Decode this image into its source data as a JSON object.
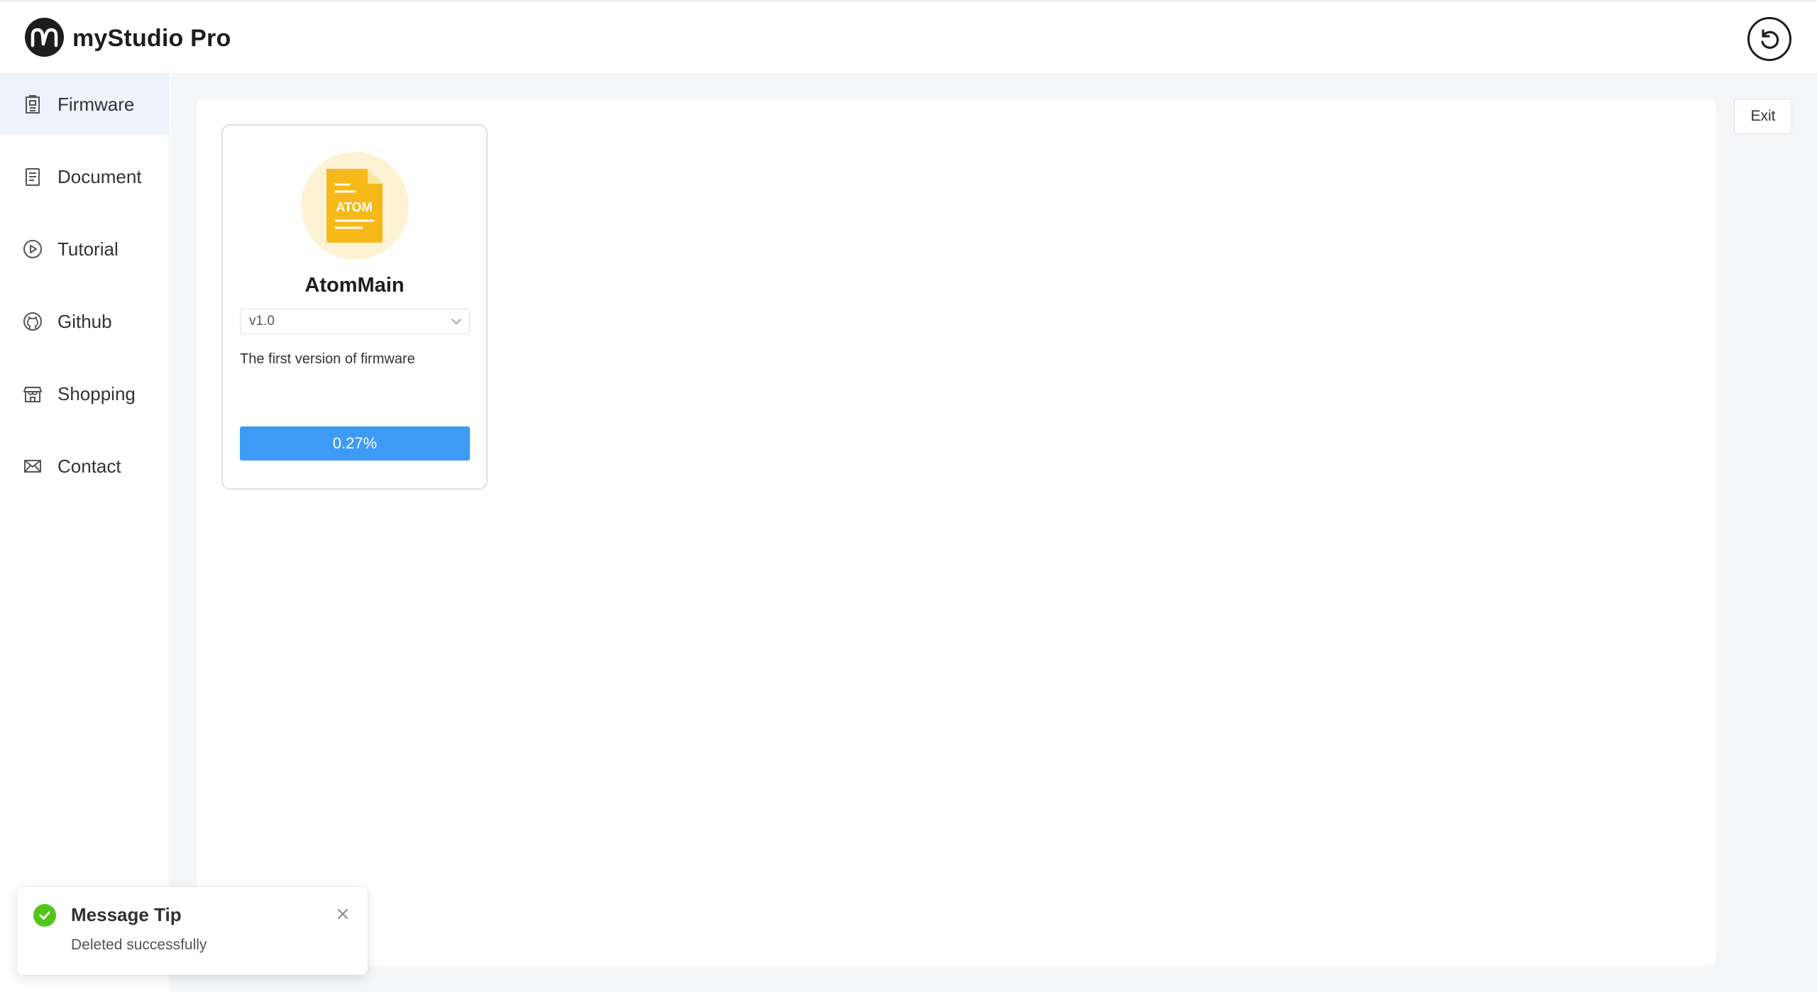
{
  "app": {
    "title": "myStudio Pro",
    "logo_icon": "mystudio-logo-icon",
    "reset_icon": "reset-icon"
  },
  "sidebar": {
    "items": [
      {
        "label": "Firmware",
        "icon": "firmware-icon",
        "active": true
      },
      {
        "label": "Document",
        "icon": "document-icon",
        "active": false
      },
      {
        "label": "Tutorial",
        "icon": "play-circle-icon",
        "active": false
      },
      {
        "label": "Github",
        "icon": "github-icon",
        "active": false
      },
      {
        "label": "Shopping",
        "icon": "shop-icon",
        "active": false
      },
      {
        "label": "Contact",
        "icon": "mail-icon",
        "active": false
      }
    ]
  },
  "toolbar": {
    "exit_label": "Exit"
  },
  "firmware_card": {
    "icon_label": "ATOM",
    "name": "AtomMain",
    "version": "v1.0",
    "description": "The first version of firmware",
    "progress_label": "0.27%",
    "progress_value": 0.27
  },
  "toast": {
    "title": "Message Tip",
    "message": "Deleted successfully",
    "status": "success"
  },
  "colors": {
    "accent": "#3d9bf7",
    "success": "#52c41a",
    "active_nav_bg": "#eef2fb",
    "file_icon": "#f7b819"
  }
}
